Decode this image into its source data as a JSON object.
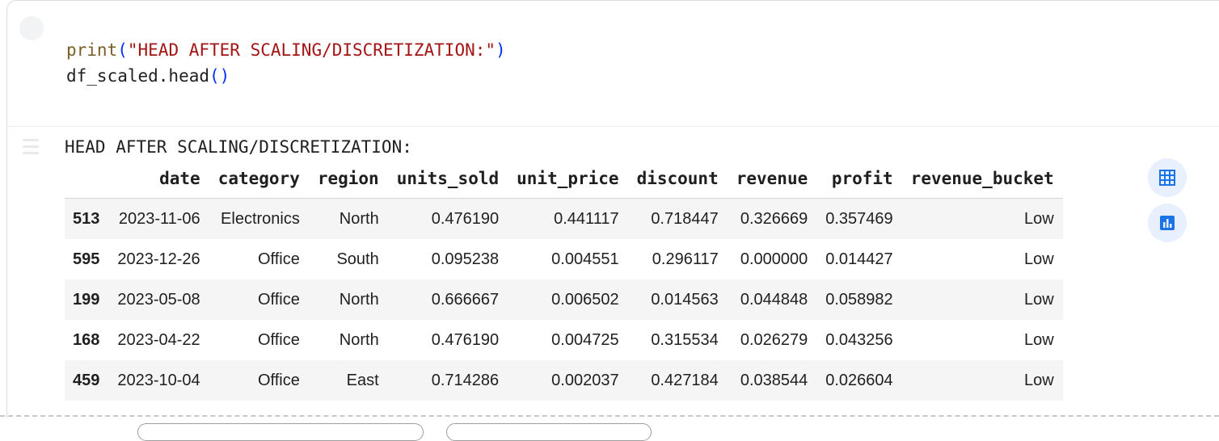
{
  "code": {
    "print_fn": "print",
    "open_paren": "(",
    "string_literal": "\"HEAD AFTER SCALING/DISCRETIZATION:\"",
    "close_paren": ")",
    "line2_object": "df_scaled.head",
    "line2_parens": "()"
  },
  "output": {
    "stdout": "HEAD AFTER SCALING/DISCRETIZATION:"
  },
  "table": {
    "columns": [
      "",
      "date",
      "category",
      "region",
      "units_sold",
      "unit_price",
      "discount",
      "revenue",
      "profit",
      "revenue_bucket"
    ],
    "rows": [
      {
        "index": "513",
        "cells": [
          "2023-11-06",
          "Electronics",
          "North",
          "0.476190",
          "0.441117",
          "0.718447",
          "0.326669",
          "0.357469",
          "Low"
        ]
      },
      {
        "index": "595",
        "cells": [
          "2023-12-26",
          "Office",
          "South",
          "0.095238",
          "0.004551",
          "0.296117",
          "0.000000",
          "0.014427",
          "Low"
        ]
      },
      {
        "index": "199",
        "cells": [
          "2023-05-08",
          "Office",
          "North",
          "0.666667",
          "0.006502",
          "0.014563",
          "0.044848",
          "0.058982",
          "Low"
        ]
      },
      {
        "index": "168",
        "cells": [
          "2023-04-22",
          "Office",
          "North",
          "0.476190",
          "0.004725",
          "0.315534",
          "0.026279",
          "0.043256",
          "Low"
        ]
      },
      {
        "index": "459",
        "cells": [
          "2023-10-04",
          "Office",
          "East",
          "0.714286",
          "0.002037",
          "0.427184",
          "0.038544",
          "0.026604",
          "Low"
        ]
      }
    ]
  },
  "side_buttons": [
    {
      "icon": "table-icon"
    },
    {
      "icon": "bar-chart-icon"
    }
  ],
  "colors": {
    "accent": "#1a73e8",
    "button_bg": "#e8f0fe"
  }
}
